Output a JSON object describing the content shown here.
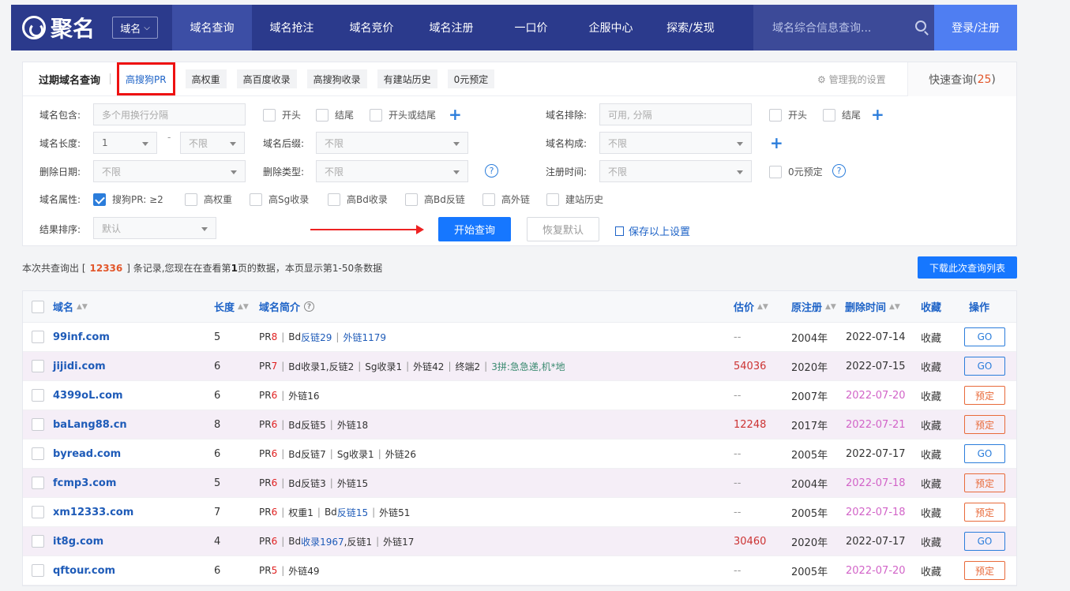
{
  "header": {
    "logo": "聚名",
    "domain_select": "域名",
    "nav": [
      "域名查询",
      "域名抢注",
      "域名竞价",
      "域名注册",
      "一口价",
      "企服中心",
      "探索/发现"
    ],
    "search_placeholder": "域名综合信息查询...",
    "login": "登录/注册"
  },
  "filters": {
    "title": "过期域名查询",
    "quick_tags": [
      "高搜狗PR",
      "高权重",
      "高百度收录",
      "高搜狗收录",
      "有建站历史",
      "0元预定"
    ],
    "manage": "管理我的设置",
    "quick_query_label": "快速查询",
    "quick_query_count": "25",
    "contains_label": "域名包含:",
    "contains_placeholder": "多个用换行分隔",
    "cb_start": "开头",
    "cb_end": "结尾",
    "cb_start_or_end": "开头或结尾",
    "exclude_label": "域名排除:",
    "exclude_placeholder": "可用, 分隔",
    "length_label": "域名长度:",
    "length_min": "1",
    "length_dash": "-",
    "length_max": "不限",
    "suffix_label": "域名后缀:",
    "suffix_value": "不限",
    "compose_label": "域名构成:",
    "compose_value": "不限",
    "delete_date_label": "删除日期:",
    "delete_date_value": "不限",
    "delete_type_label": "删除类型:",
    "delete_type_value": "不限",
    "reg_time_label": "注册时间:",
    "reg_time_value": "不限",
    "zero_reserve": "0元预定",
    "help": "?",
    "attr_label": "域名属性:",
    "attr_sogou_pr": "搜狗PR: ≥2",
    "attrs": [
      "高权重",
      "高Sg收录",
      "高Bd收录",
      "高Bd反链",
      "高外链",
      "建站历史"
    ],
    "sort_label": "结果排序:",
    "sort_value": "默认",
    "start_query": "开始查询",
    "reset": "恢复默认",
    "save": "保存以上设置"
  },
  "summary": {
    "prefix": "本次共查询出 [",
    "count": "12336",
    "middle": "] 条记录,您现在在查看第",
    "page": "1",
    "suffix": "页的数据，本页显示第1-50条数据"
  },
  "download": "下载此次查询列表",
  "columns": {
    "domain": "域名",
    "length": "长度",
    "desc": "域名简介",
    "price": "估价",
    "orig_reg": "原注册",
    "delete_time": "删除时间",
    "fav": "收藏",
    "op": "操作",
    "sort_mark": "▲▼",
    "help_mark": "?"
  },
  "rows": [
    {
      "domain": "99inf.com",
      "len": "5",
      "pr": "8",
      "parts": [
        {
          "t": "Bd"
        },
        {
          "t": "反链29",
          "c": "b"
        },
        {
          "t": "外链1179",
          "c": "b",
          "sep": true
        }
      ],
      "price": "--",
      "reg": "2004年",
      "del": "2022-07-14",
      "del_pink": false,
      "fav": "收藏",
      "op": "GO"
    },
    {
      "domain": "jijidi.com",
      "len": "6",
      "pr": "7",
      "parts": [
        {
          "t": "Bd收录1,反链2"
        },
        {
          "t": "Sg收录1",
          "sep": true
        },
        {
          "t": "外链42",
          "sep": true
        },
        {
          "t": "终端2",
          "sep": true
        },
        {
          "t": "3拼:急急递,机*地",
          "c": "g",
          "sep": true
        }
      ],
      "price": "54036",
      "reg": "2020年",
      "del": "2022-07-15",
      "del_pink": false,
      "fav": "收藏",
      "op": "GO"
    },
    {
      "domain": "4399oL.com",
      "len": "6",
      "pr": "6",
      "parts": [
        {
          "t": "外链16"
        }
      ],
      "price": "--",
      "reg": "2007年",
      "del": "2022-07-20",
      "del_pink": true,
      "fav": "收藏",
      "op": "预定"
    },
    {
      "domain": "baLang88.cn",
      "len": "8",
      "pr": "6",
      "parts": [
        {
          "t": "Bd反链5"
        },
        {
          "t": "外链18",
          "sep": true
        }
      ],
      "price": "12248",
      "reg": "2017年",
      "del": "2022-07-21",
      "del_pink": true,
      "fav": "收藏",
      "op": "预定"
    },
    {
      "domain": "byread.com",
      "len": "6",
      "pr": "6",
      "parts": [
        {
          "t": "Bd反链7"
        },
        {
          "t": "Sg收录1",
          "sep": true
        },
        {
          "t": "外链26",
          "sep": true
        }
      ],
      "price": "--",
      "reg": "2005年",
      "del": "2022-07-17",
      "del_pink": false,
      "fav": "收藏",
      "op": "GO"
    },
    {
      "domain": "fcmp3.com",
      "len": "5",
      "pr": "6",
      "parts": [
        {
          "t": "Bd反链3"
        },
        {
          "t": "外链15",
          "sep": true
        }
      ],
      "price": "--",
      "reg": "2004年",
      "del": "2022-07-18",
      "del_pink": true,
      "fav": "收藏",
      "op": "预定"
    },
    {
      "domain": "xm12333.com",
      "len": "7",
      "pr": "6",
      "parts": [
        {
          "t": "权重1"
        },
        {
          "t": "Bd",
          "sep": true
        },
        {
          "t": "反链15",
          "c": "b"
        },
        {
          "t": "外链51",
          "sep": true
        }
      ],
      "price": "--",
      "reg": "2005年",
      "del": "2022-07-18",
      "del_pink": true,
      "fav": "收藏",
      "op": "预定"
    },
    {
      "domain": "it8g.com",
      "len": "4",
      "pr": "6",
      "parts": [
        {
          "t": "Bd"
        },
        {
          "t": "收录1967",
          "c": "b"
        },
        {
          "t": ",反链1"
        },
        {
          "t": "外链17",
          "sep": true
        }
      ],
      "price": "30460",
      "reg": "2020年",
      "del": "2022-07-17",
      "del_pink": false,
      "fav": "收藏",
      "op": "GO"
    },
    {
      "domain": "qftour.com",
      "len": "6",
      "pr": "5",
      "parts": [
        {
          "t": "外链49"
        }
      ],
      "price": "--",
      "reg": "2005年",
      "del": "2022-07-20",
      "del_pink": true,
      "fav": "收藏",
      "op": "预定"
    }
  ]
}
